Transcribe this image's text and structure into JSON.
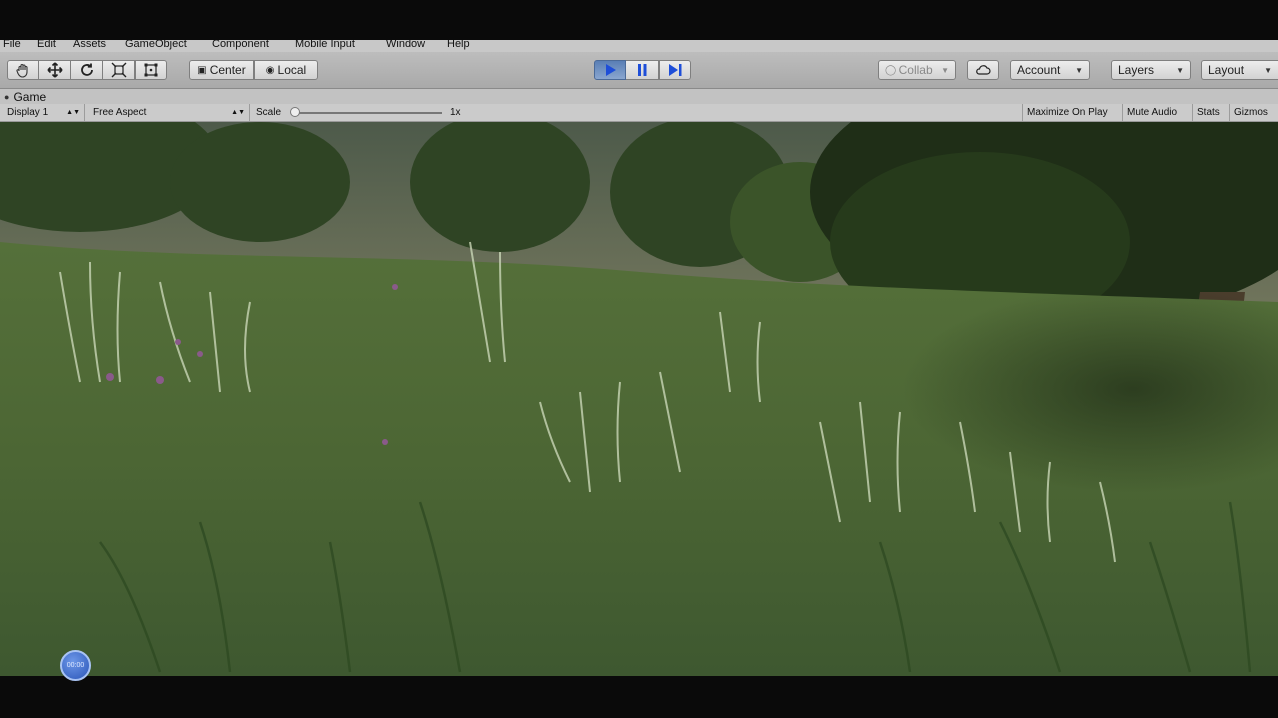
{
  "menubar": {
    "items": [
      "File",
      "Edit",
      "Assets",
      "GameObject",
      "Component",
      "Mobile Input",
      "Window",
      "Help"
    ]
  },
  "toolbar": {
    "transform_tools": [
      "hand-icon",
      "move-icon",
      "rotate-icon",
      "scale-icon",
      "rect-icon"
    ],
    "pivot_label": "Center",
    "space_label": "Local",
    "play_controls": [
      "play-icon",
      "pause-icon",
      "step-icon"
    ],
    "collab_label": "Collab",
    "account_label": "Account",
    "layers_label": "Layers",
    "layout_label": "Layout",
    "accent_color": "#4b74c9"
  },
  "tab": {
    "title": "Game"
  },
  "gamebar": {
    "display": "Display 1",
    "aspect": "Free Aspect",
    "scale_label": "Scale",
    "scale_value": "1x",
    "scale_level": 0,
    "maximize": "Maximize On Play",
    "mute": "Mute Audio",
    "stats": "Stats",
    "gizmos": "Gizmos"
  },
  "overlay": {
    "timer": "00:00"
  }
}
